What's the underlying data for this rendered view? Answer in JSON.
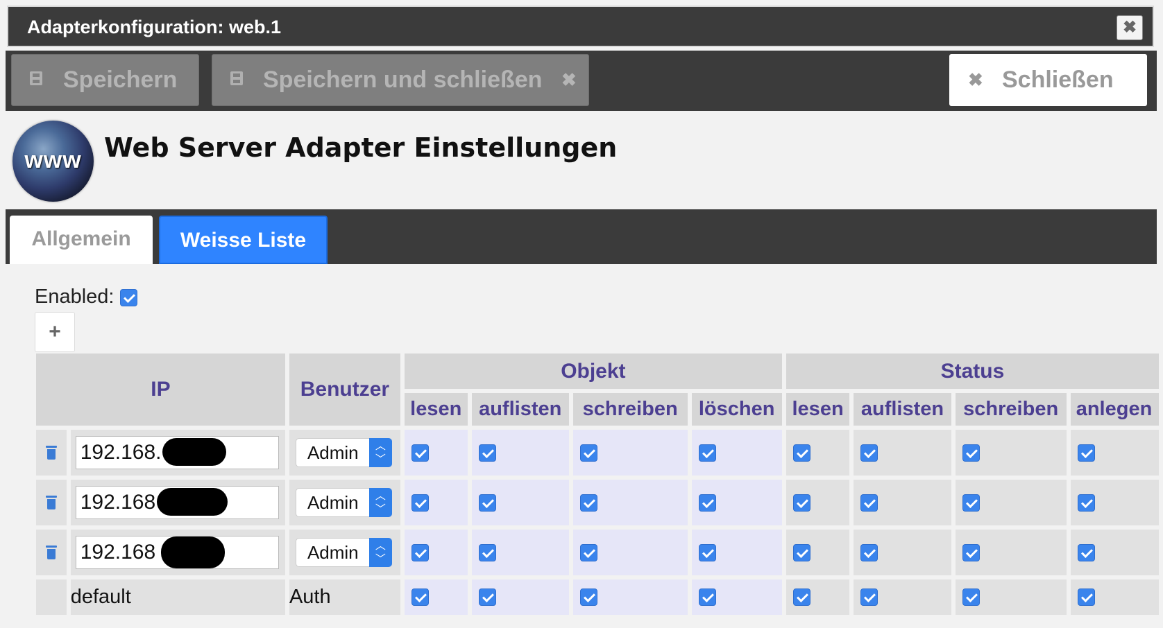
{
  "dialog": {
    "title": "Adapterkonfiguration: web.1",
    "close_icon": "✖"
  },
  "toolbar": {
    "save_label": "Speichern",
    "save_close_label": "Speichern und schließen",
    "close_label": "Schließen",
    "x_glyph": "✖"
  },
  "header": {
    "logo_text": "www",
    "title": "Web Server Adapter Einstellungen"
  },
  "tabs": [
    {
      "label": "Allgemein",
      "active": false
    },
    {
      "label": "Weisse Liste",
      "active": true
    }
  ],
  "whitelist": {
    "enabled_label": "Enabled:",
    "enabled": true,
    "add_glyph": "+",
    "columns": {
      "ip": "IP",
      "user": "Benutzer",
      "group_object": "Objekt",
      "group_state": "Status",
      "object": [
        "lesen",
        "auflisten",
        "schreiben",
        "löschen"
      ],
      "state": [
        "lesen",
        "auflisten",
        "schreiben",
        "anlegen"
      ]
    },
    "rows": [
      {
        "ip": "192.168.",
        "user": "Admin",
        "perms": [
          true,
          true,
          true,
          true,
          true,
          true,
          true,
          true
        ]
      },
      {
        "ip": "192.168",
        "user": "Admin",
        "perms": [
          true,
          true,
          true,
          true,
          true,
          true,
          true,
          true
        ]
      },
      {
        "ip": "192.168",
        "user": "Admin",
        "perms": [
          true,
          true,
          true,
          true,
          true,
          true,
          true,
          true
        ]
      }
    ],
    "default_row": {
      "ip": "default",
      "user": "Auth",
      "perms": [
        true,
        true,
        true,
        true,
        true,
        true,
        true,
        true
      ]
    }
  },
  "colors": {
    "bar_dark": "#3b3b3b",
    "tab_active": "#2f84ff",
    "header_text": "#4c3f91",
    "checkbox": "#3a84ec",
    "object_cell_bg": "#e6e6f8"
  }
}
